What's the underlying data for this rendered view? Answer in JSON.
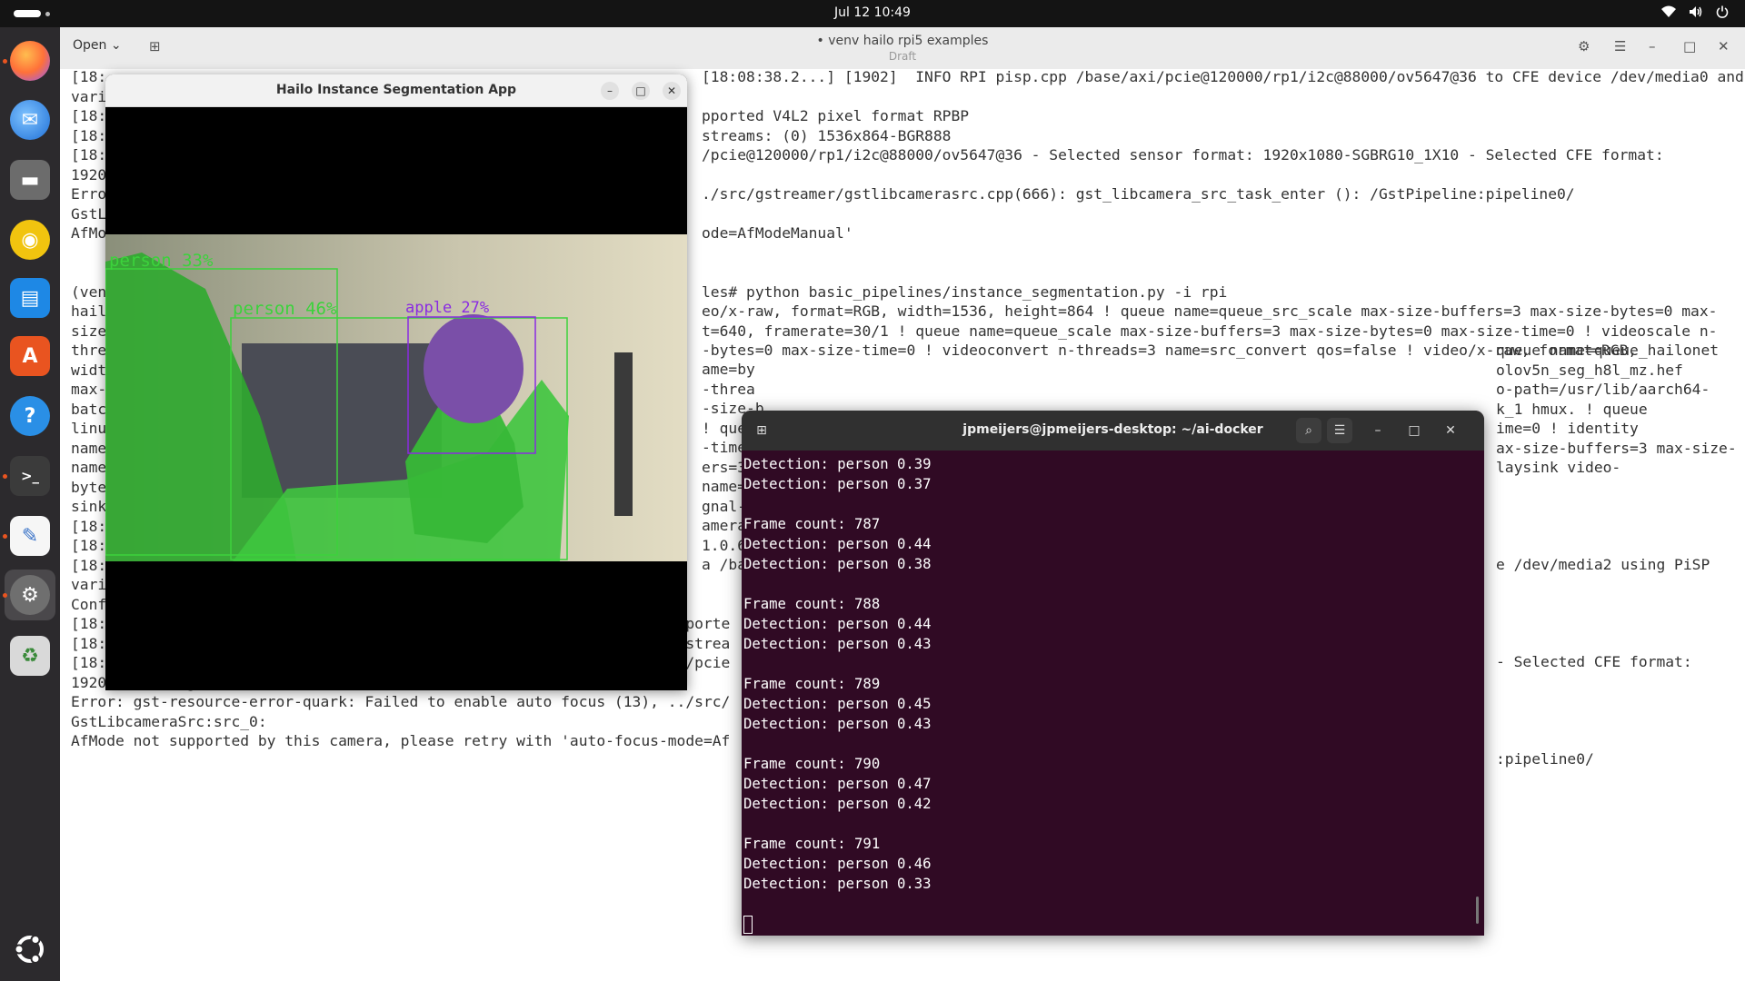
{
  "topbar": {
    "clock": "Jul 12  10:49",
    "icons": [
      "wifi-icon",
      "volume-icon",
      "power-icon"
    ]
  },
  "dock": {
    "apps": [
      "firefox",
      "thunderbird",
      "files",
      "rhythmbox",
      "writer",
      "app-center",
      "help",
      "terminal",
      "text-editor",
      "settings",
      "trash"
    ],
    "active": "settings",
    "bottom": "ubuntu-logo"
  },
  "editor": {
    "open_label": "Open",
    "title": "• venv hailo rpi5 examples",
    "subtitle": "Draft",
    "lines": [
      "[18:",
      "vari",
      "[18:",
      "[18:",
      "[18:",
      "1920",
      "Erro",
      "GstL",
      "AfMo",
      "",
      "",
      "(ven",
      "hail",
      "size",
      "thre",
      "widt",
      "max-",
      "batc",
      "linu",
      "name",
      "name",
      "byte",
      "sink",
      "[18:",
      "[18:",
      "[18:",
      "variant BCM2712_C0",
      "Config file doesn't exist, using default parameters",
      "[18:08:38.258342604] [1902]  WARN V4L2 v4l2_pixelformat.cpp:344 Unsupporte",
      "[18:08:38.260380681] [1902]  INFO Camera camera.cpp:1183 configuring strea",
      "[18:08:38.260549348] [1888]  INFO RPI pisp.cpp:1450 Sensor: /base/axi/pcie",
      "1920x1080-PC1g",
      "Error: gst-resource-error-quark: Failed to enable auto focus (13), ../src/",
      "GstLibcameraSrc:src_0:",
      "AfMode not supported by this camera, please retry with 'auto-focus-mode=Af"
    ],
    "mid_lines": [
      "[18:08:38.2...] [1902]  INFO RPI pisp.cpp /base/axi/pcie@120000/rp1/i2c@88000/ov5647@36 to CFE device /dev/media0 and ISP device /dev/media2 using PiSP",
      "",
      "pported V4L2 pixel format RPBP",
      "streams: (0) 1536x864-BGR888",
      "/pcie@120000/rp1/i2c@88000/ov5647@36 - Selected sensor format: 1920x1080-SGBRG10_1X10 - Selected CFE format:",
      "",
      "./src/gstreamer/gstlibcamerasrc.cpp(666): gst_libcamera_src_task_enter (): /GstPipeline:pipeline0/",
      "",
      "ode=AfModeManual'",
      "",
      "",
      "les# python basic_pipelines/instance_segmentation.py -i rpi",
      "eo/x-raw, format=RGB, width=1536, height=864 ! queue name=queue_src_scale max-size-buffers=3 max-size-bytes=0 max-",
      "t=640, framerate=30/1 ! queue name=queue_scale max-size-buffers=3 max-size-bytes=0 max-size-time=0 ! videoscale n-",
      "-bytes=0 max-size-time=0 ! videoconvert n-threads=3 name=src_convert qos=false ! video/x-raw, format=RGB,"
    ],
    "right_lines": [
      "queue name=queue_hailonet",
      "olov5n_seg_h8l_mz.hef",
      "o-path=/usr/lib/aarch64-",
      "k_1 hmux. ! queue",
      "ime=0 ! identity",
      "ax-size-buffers=3 max-size-",
      "laysink video-"
    ],
    "right_lines_2": [
      "e /dev/media2 using PiSP",
      "- Selected CFE format:",
      ":pipeline0/"
    ],
    "mid_lines_2": [
      "ame=by",
      "-threa",
      "-size-b",
      "! queu",
      "-time=",
      "ers=3",
      "name=",
      "gnal-f",
      "amera",
      "1.0.6",
      "a /bas"
    ]
  },
  "hailo_window": {
    "title": "Hailo Instance Segmentation App",
    "detections": [
      {
        "label": "person 33%",
        "color": "#3cd23c"
      },
      {
        "label": "person 46%",
        "color": "#3cd23c"
      },
      {
        "label": "apple 27%",
        "color": "#8a2be2"
      }
    ]
  },
  "terminal": {
    "title": "jpmeijers@jpmeijers-desktop: ~/ai-docker",
    "lines": [
      "Detection: person 0.39",
      "Detection: person 0.37",
      "",
      "Frame count: 787",
      "Detection: person 0.44",
      "Detection: person 0.38",
      "",
      "Frame count: 788",
      "Detection: person 0.44",
      "Detection: person 0.43",
      "",
      "Frame count: 789",
      "Detection: person 0.45",
      "Detection: person 0.43",
      "",
      "Frame count: 790",
      "Detection: person 0.47",
      "Detection: person 0.42",
      "",
      "Frame count: 791",
      "Detection: person 0.46",
      "Detection: person 0.33"
    ]
  }
}
